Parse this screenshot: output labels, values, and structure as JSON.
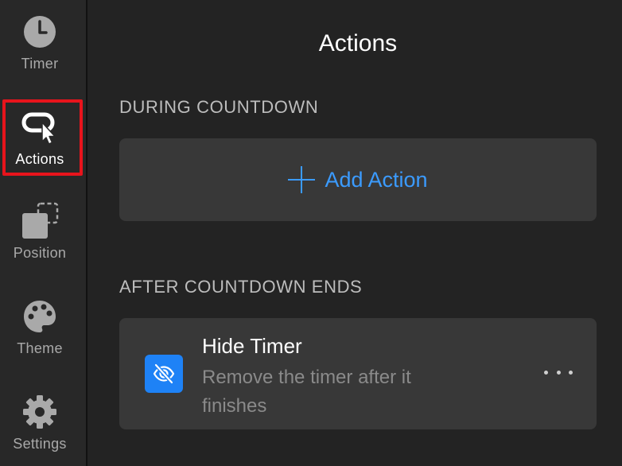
{
  "sidebar": {
    "items": [
      {
        "label": "Timer",
        "icon": "clock-icon",
        "active": false
      },
      {
        "label": "Actions",
        "icon": "action-cursor-icon",
        "active": true
      },
      {
        "label": "Position",
        "icon": "position-icon",
        "active": false
      },
      {
        "label": "Theme",
        "icon": "palette-icon",
        "active": false
      },
      {
        "label": "Settings",
        "icon": "gear-icon",
        "active": false
      }
    ]
  },
  "main": {
    "title": "Actions",
    "during": {
      "header": "DURING COUNTDOWN",
      "add_label": "Add Action"
    },
    "after": {
      "header": "AFTER COUNTDOWN ENDS",
      "action": {
        "title": "Hide Timer",
        "description": "Remove the timer after it finishes",
        "icon": "eye-slash-icon"
      }
    }
  },
  "colors": {
    "accent": "#3b9bff",
    "icon_tile": "#1e82f6",
    "highlight": "#e8141c",
    "background": "#232323",
    "sidebar": "#282828",
    "card": "#383838"
  }
}
